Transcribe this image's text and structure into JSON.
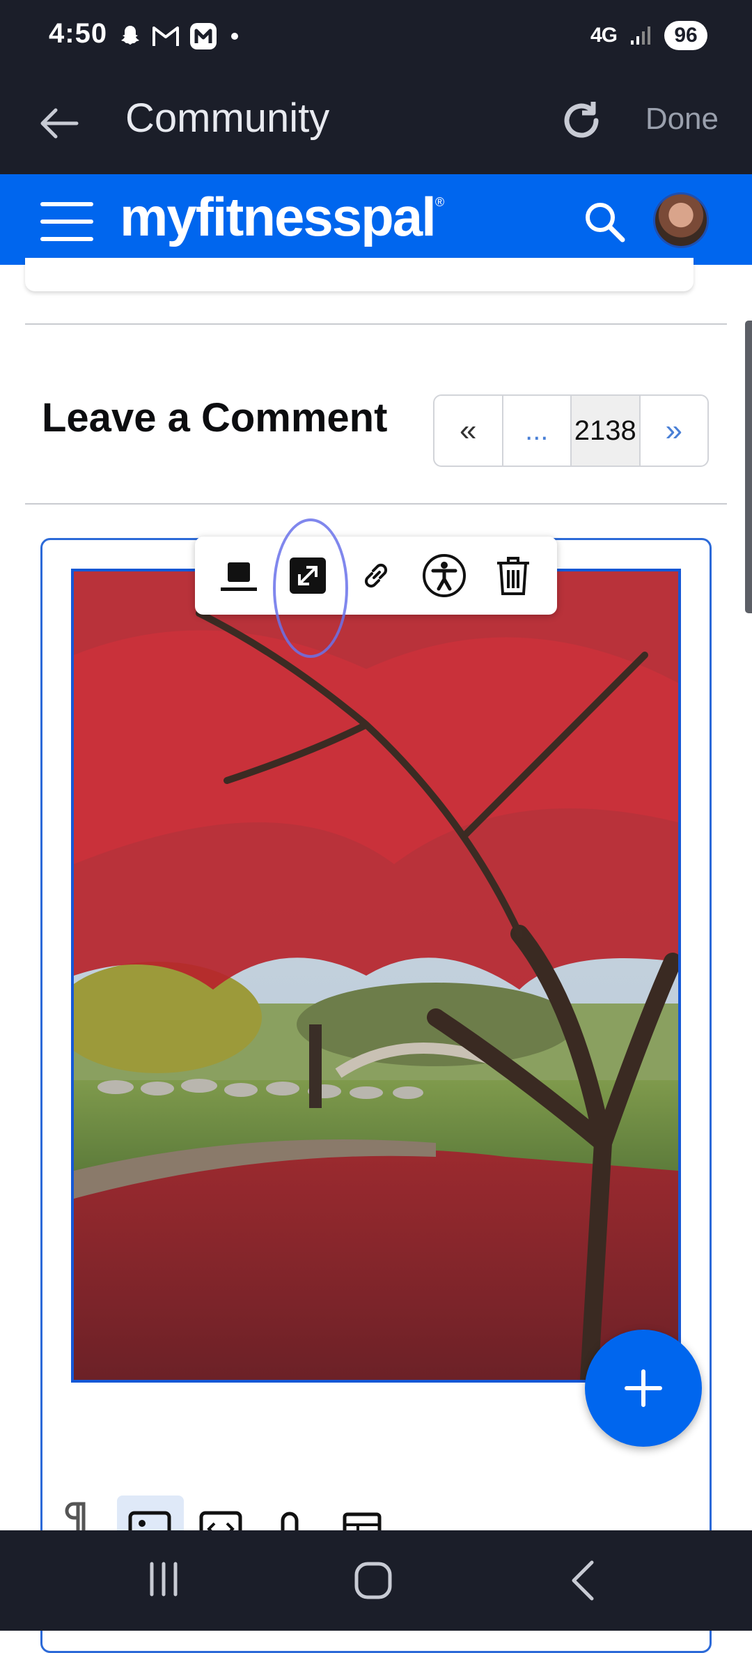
{
  "status_bar": {
    "time": "4:50",
    "network": "4G",
    "battery": "96"
  },
  "webview": {
    "title": "Community",
    "done_label": "Done"
  },
  "site": {
    "brand": "myfitnesspal",
    "brand_mark": "®"
  },
  "content": {
    "section_title": "Leave a Comment",
    "pager": {
      "first": "«",
      "ellipsis": "...",
      "current": "2138",
      "next": "»"
    }
  },
  "image_toolbar": {
    "tools": [
      "inline-image-icon",
      "expand-icon",
      "link-icon",
      "accessibility-icon",
      "trash-icon"
    ]
  },
  "colors": {
    "brand_blue": "#0066ee",
    "dark_chrome": "#1b1e29",
    "annotation": "#6a72ea"
  }
}
